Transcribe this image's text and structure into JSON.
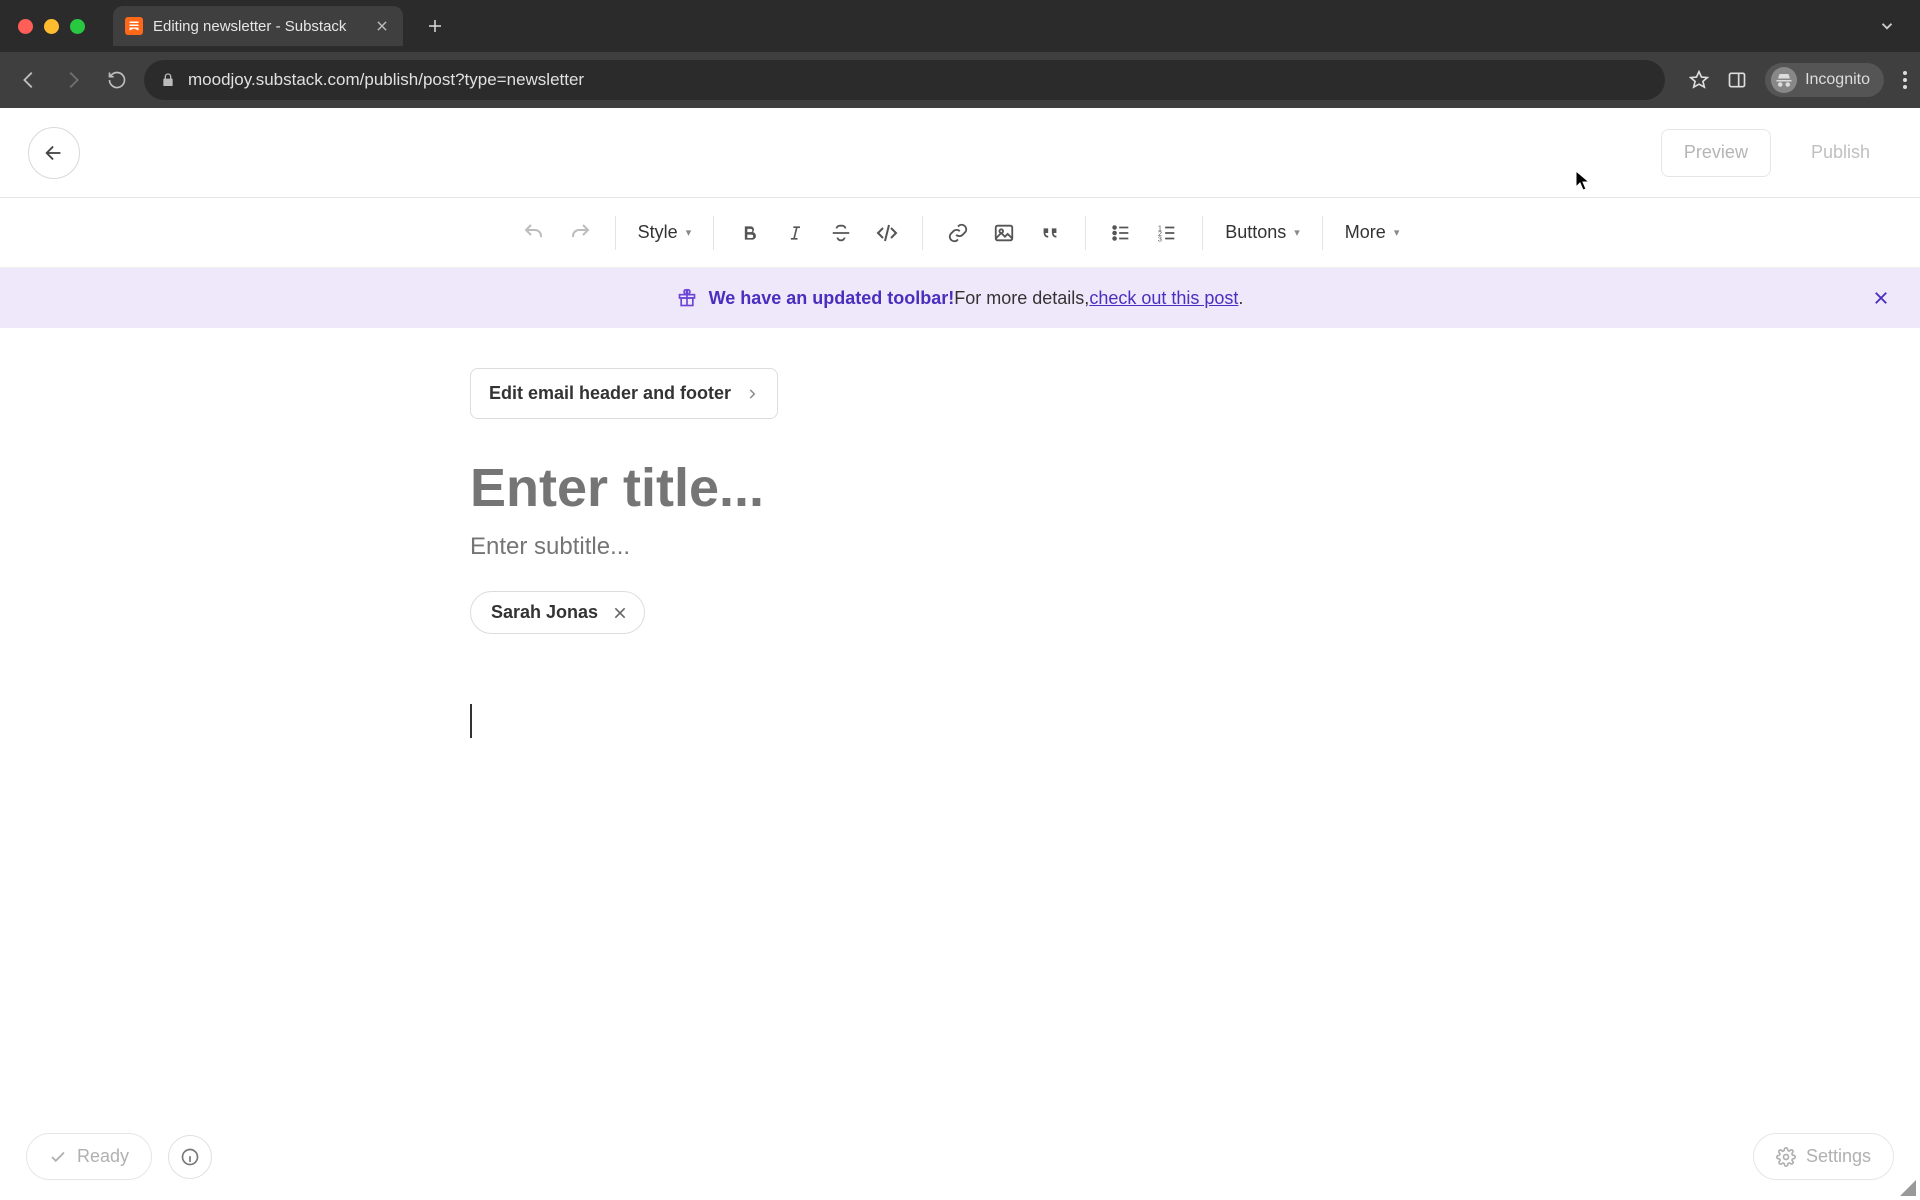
{
  "browser": {
    "tab_title": "Editing newsletter - Substack",
    "url": "moodjoy.substack.com/publish/post?type=newsletter",
    "incognito_label": "Incognito"
  },
  "header": {
    "preview": "Preview",
    "publish": "Publish"
  },
  "toolbar": {
    "style": "Style",
    "buttons": "Buttons",
    "more": "More"
  },
  "banner": {
    "bold": "We have an updated toolbar!",
    "plain": " For more details, ",
    "link": "check out this post",
    "tail": "."
  },
  "editor": {
    "edit_email_hf": "Edit email header and footer",
    "title_placeholder": "Enter title...",
    "subtitle_placeholder": "Enter subtitle...",
    "author": "Sarah Jonas"
  },
  "footer": {
    "ready": "Ready",
    "settings": "Settings"
  }
}
